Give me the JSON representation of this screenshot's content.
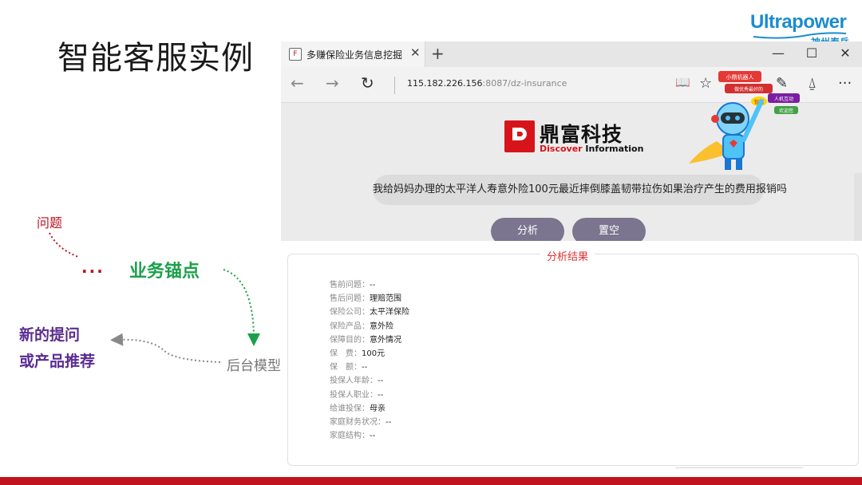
{
  "slide": {
    "title": "智能客服实例",
    "logo": {
      "main": "Ultrapower",
      "sub": "神州泰岳"
    },
    "labels": {
      "question": "问题",
      "dots": "···",
      "business_anchor": "业务锚点",
      "new_question_line1": "新的提问",
      "new_question_line2": "或产品推荐",
      "backend_model": "后台模型"
    },
    "colors": {
      "accent_red": "#c0121f",
      "green": "#1aa04a",
      "purple": "#5a2d91",
      "gray": "#777777"
    }
  },
  "browser": {
    "tab": {
      "title": "多赚保险业务信息挖掘",
      "close": "✕",
      "new_tab": "+"
    },
    "window_controls": {
      "minimize": "—",
      "maximize": "☐",
      "close": "✕"
    },
    "nav": {
      "back": "←",
      "forward": "→",
      "refresh": "↻"
    },
    "url": {
      "host": "115.182.226.156",
      "rest": ":8087/dz-insurance"
    },
    "toolbar_icons": [
      "reading-view-icon",
      "favorite-star-icon",
      "notes-icon",
      "share-icon",
      "more-icon"
    ],
    "toolbar_glyphs": {
      "reading": "📖",
      "star": "☆",
      "pen": "✎",
      "share": "⍙",
      "more": "···"
    }
  },
  "page": {
    "brand_cn": "鼎富科技",
    "brand_en_1": "Discover ",
    "brand_en_2": "Information",
    "query": "我给妈妈办理的太平洋人寿意外险100元最近摔倒膝盖韧带拉伤如果治疗产生的费用报销吗",
    "analyze_button": "分析",
    "reset_button": "置空",
    "mascot_text": [
      "小鼎机器人",
      "做优秀最好的",
      "智能",
      "人机互动",
      "欢迎您"
    ]
  },
  "result": {
    "title": "分析结果",
    "rows": [
      {
        "key": "售前问题：",
        "value": "--"
      },
      {
        "key": "售后问题：",
        "value": "理赔范围"
      },
      {
        "key": "保险公司：",
        "value": "太平洋保险"
      },
      {
        "key": "保险产品：",
        "value": "意外险"
      },
      {
        "key": "保障目的：",
        "value": "意外情况"
      },
      {
        "key": "保　费：",
        "value": "100元"
      },
      {
        "key": "保　额：",
        "value": "--"
      },
      {
        "key": "投保人年龄：",
        "value": "--"
      },
      {
        "key": "投保人职业：",
        "value": "--"
      },
      {
        "key": "给谁投保：",
        "value": "母亲"
      },
      {
        "key": "家庭财务状况：",
        "value": "--"
      },
      {
        "key": "家庭结构：",
        "value": "--"
      }
    ]
  }
}
